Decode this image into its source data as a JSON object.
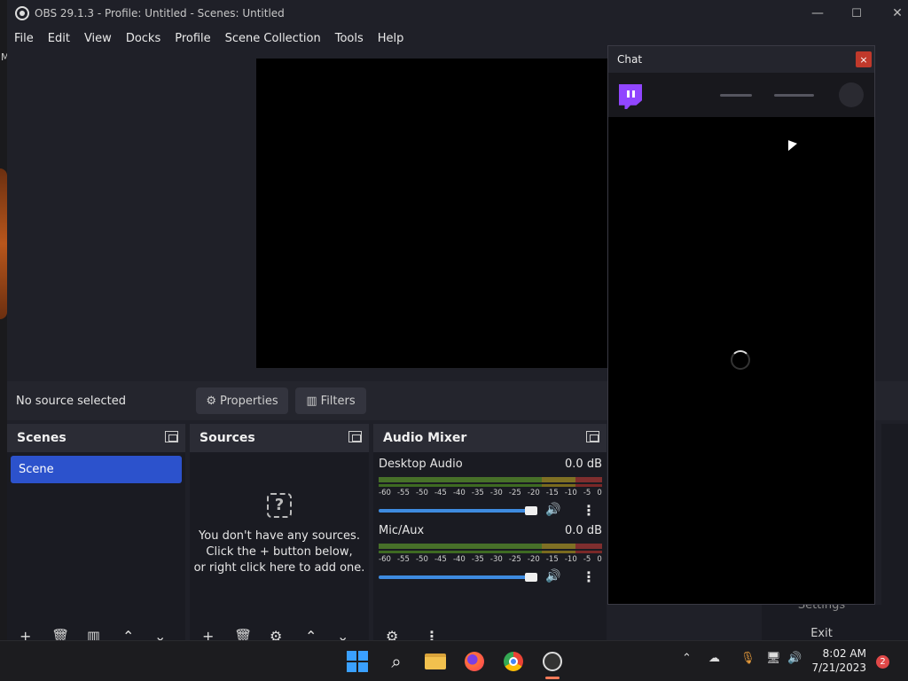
{
  "window": {
    "title": "OBS 29.1.3 - Profile: Untitled - Scenes: Untitled",
    "minimize": "—",
    "maximize": "☐",
    "close": "✕"
  },
  "menu": [
    "File",
    "Edit",
    "View",
    "Docks",
    "Profile",
    "Scene Collection",
    "Tools",
    "Help"
  ],
  "context_bar": {
    "no_source": "No source selected",
    "properties": "Properties",
    "filters": "Filters"
  },
  "scenes": {
    "title": "Scenes",
    "items": [
      "Scene"
    ]
  },
  "sources": {
    "title": "Sources",
    "empty_line1": "You don't have any sources.",
    "empty_line2": "Click the + button below,",
    "empty_line3": "or right click here to add one."
  },
  "mixer": {
    "title": "Audio Mixer",
    "ticks": [
      "-60",
      "-55",
      "-50",
      "-45",
      "-40",
      "-35",
      "-30",
      "-25",
      "-20",
      "-15",
      "-10",
      "-5",
      "0"
    ],
    "channels": [
      {
        "name": "Desktop Audio",
        "db": "0.0 dB",
        "volume": 1.0
      },
      {
        "name": "Mic/Aux",
        "db": "0.0 dB",
        "volume": 1.0
      }
    ]
  },
  "chat": {
    "title": "Chat",
    "close": "×"
  },
  "controls": {
    "settings": "Settings",
    "exit": "Exit"
  },
  "taskbar": {
    "time": "8:02 AM",
    "date": "7/21/2023",
    "notifications": "2"
  },
  "colors": {
    "accent": "#2c52cc",
    "twitch": "#9146ff",
    "volume": "#3e8be0"
  },
  "left_edge_text": "M"
}
